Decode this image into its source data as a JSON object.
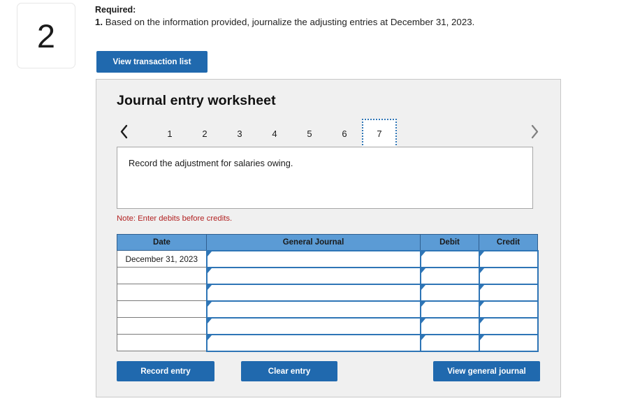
{
  "question_number": "2",
  "required": {
    "label": "Required:",
    "item_number": "1.",
    "item_text": "Based on the information provided, journalize the adjusting entries at December 31, 2023."
  },
  "view_transaction_list_button": "View transaction list",
  "worksheet": {
    "title": "Journal entry worksheet",
    "prev_arrow": "chevron-left",
    "next_arrow": "chevron-right",
    "tabs": [
      {
        "label": "1",
        "selected": false
      },
      {
        "label": "2",
        "selected": false
      },
      {
        "label": "3",
        "selected": false
      },
      {
        "label": "4",
        "selected": false
      },
      {
        "label": "5",
        "selected": false
      },
      {
        "label": "6",
        "selected": false
      },
      {
        "label": "7",
        "selected": true
      }
    ],
    "instruction": "Record the adjustment for salaries owing.",
    "note": "Note: Enter debits before credits.",
    "table": {
      "headers": [
        "Date",
        "General Journal",
        "Debit",
        "Credit"
      ],
      "rows": [
        {
          "date": "December 31, 2023",
          "general_journal": "",
          "debit": "",
          "credit": ""
        },
        {
          "date": "",
          "general_journal": "",
          "debit": "",
          "credit": ""
        },
        {
          "date": "",
          "general_journal": "",
          "debit": "",
          "credit": ""
        },
        {
          "date": "",
          "general_journal": "",
          "debit": "",
          "credit": ""
        },
        {
          "date": "",
          "general_journal": "",
          "debit": "",
          "credit": ""
        },
        {
          "date": "",
          "general_journal": "",
          "debit": "",
          "credit": ""
        }
      ]
    },
    "buttons": {
      "record_entry": "Record entry",
      "clear_entry": "Clear entry",
      "view_general_journal": "View general journal"
    }
  },
  "colors": {
    "button_blue": "#2069ae",
    "header_blue": "#5b9bd5",
    "field_border_blue": "#2e75b6",
    "panel_bg": "#f0f0f0",
    "note_red": "#b22222"
  }
}
